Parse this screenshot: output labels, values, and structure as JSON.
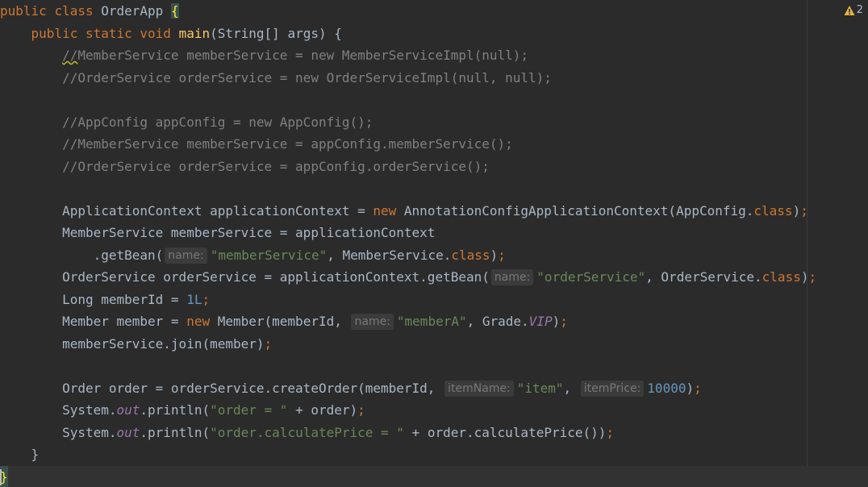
{
  "inspection": {
    "warning_count": "2",
    "icon": "warning-triangle-icon",
    "color": "#e3b341"
  },
  "code": {
    "l1_kw1": "public",
    "l1_kw2": "class",
    "l1_name": "OrderApp",
    "l1_brace": "{",
    "l2_kw1": "public",
    "l2_kw2": "static",
    "l2_kw3": "void",
    "l2_fn": "main",
    "l2_rest": "(String[] args) {",
    "l3_a": "//",
    "l3_b": "MemberService memberService = new MemberServiceImpl(null);",
    "l4": "//OrderService orderService = new OrderServiceImpl(null, null);",
    "l6": "//AppConfig appConfig = new AppConfig();",
    "l7": "//MemberService memberService = appConfig.memberService();",
    "l8": "//OrderService orderService = appConfig.orderService();",
    "l10_a": "ApplicationContext applicationContext = ",
    "l10_new": "new",
    "l10_b": " AnnotationConfigApplicationContext(AppConfig.",
    "l10_class": "class",
    "l10_c": ")",
    "l10_semi": ";",
    "l11": "MemberService memberService = applicationContext",
    "l12_a": ".getBean(",
    "l12_hint": "name:",
    "l12_str": "\"memberService\"",
    "l12_b": ", MemberService.",
    "l12_class": "class",
    "l12_c": ")",
    "l12_semi": ";",
    "l13_a": "OrderService orderService = applicationContext.getBean(",
    "l13_hint": "name:",
    "l13_str": "\"orderService\"",
    "l13_b": ", OrderService.",
    "l13_class": "class",
    "l13_c": ")",
    "l13_semi": ";",
    "l14_a": "Long memberId = ",
    "l14_num": "1L",
    "l14_semi": ";",
    "l15_a": "Member member = ",
    "l15_new": "new",
    "l15_b": " Member(memberId, ",
    "l15_hint": "name:",
    "l15_str": "\"memberA\"",
    "l15_c": ", Grade.",
    "l15_vip": "VIP",
    "l15_d": ")",
    "l15_semi": ";",
    "l16_a": "memberService.join(member)",
    "l16_semi": ";",
    "l18_a": "Order order = orderService.createOrder(memberId, ",
    "l18_hint1": "itemName:",
    "l18_str": "\"item\"",
    "l18_b": ", ",
    "l18_hint2": "itemPrice:",
    "l18_num": "10000",
    "l18_c": ")",
    "l18_semi": ";",
    "l19_a": "System.",
    "l19_out": "out",
    "l19_b": ".println(",
    "l19_str": "\"order = \"",
    "l19_c": " + order)",
    "l19_semi": ";",
    "l20_a": "System.",
    "l20_out": "out",
    "l20_b": ".println(",
    "l20_str": "\"order.calculatePrice = \"",
    "l20_c": " + order.calculatePrice())",
    "l20_semi": ";",
    "l21": "}",
    "l22": "}"
  }
}
